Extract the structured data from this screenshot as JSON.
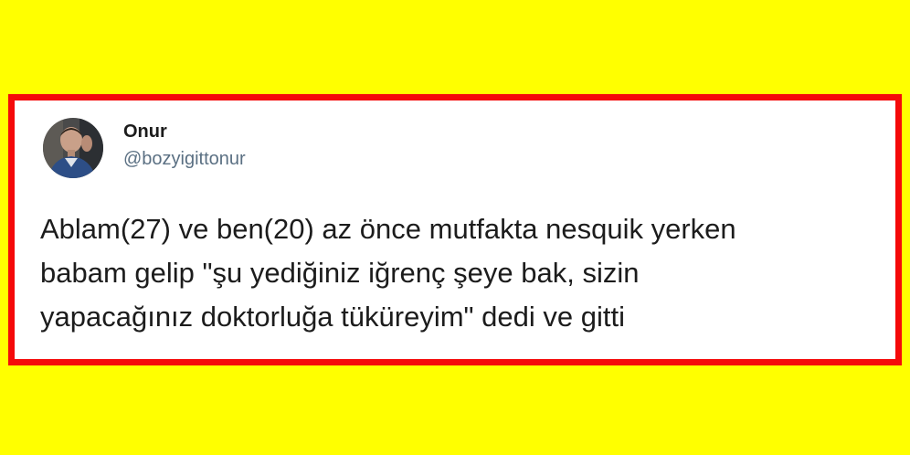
{
  "tweet": {
    "author": {
      "display_name": "Onur",
      "handle": "@bozyigittonur",
      "avatar_icon": "profile-photo"
    },
    "text": "Ablam(27) ve ben(20) az önce mutfakta nesquik yerken\nbabam gelip \"şu yediğiniz iğrenç şeye bak, sizin\nyapacağınız doktorluğa tüküreyim\" dedi ve gitti"
  },
  "colors": {
    "background": "#ffff00",
    "frame_border": "#f50a0a",
    "card": "#ffffff",
    "text": "#1c1c1c",
    "handle": "#5b7083"
  }
}
